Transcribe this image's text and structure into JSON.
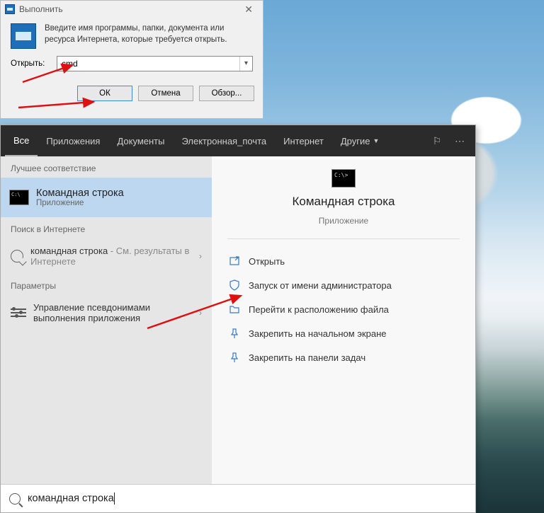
{
  "run": {
    "title": "Выполнить",
    "description": "Введите имя программы, папки, документа или ресурса Интернета, которые требуется открыть.",
    "open_label": "Открыть:",
    "value": "cmd",
    "ok": "ОК",
    "cancel": "Отмена",
    "browse": "Обзор..."
  },
  "search": {
    "tabs": {
      "all": "Все",
      "apps": "Приложения",
      "docs": "Документы",
      "email": "Электронная_почта",
      "internet": "Интернет",
      "more": "Другие"
    },
    "sections": {
      "best": "Лучшее соответствие",
      "web": "Поиск в Интернете",
      "params": "Параметры"
    },
    "best_match": {
      "title": "Командная строка",
      "subtitle": "Приложение"
    },
    "web_item": {
      "query": "командная строка",
      "suffix": " - См. результаты в Интернете"
    },
    "param_item": "Управление псевдонимами выполнения приложения",
    "detail": {
      "title": "Командная строка",
      "subtitle": "Приложение"
    },
    "actions": {
      "open": "Открыть",
      "admin": "Запуск от имени администратора",
      "location": "Перейти к расположению файла",
      "pin_start": "Закрепить на начальном экране",
      "pin_taskbar": "Закрепить на панели задач"
    },
    "input": "командная строка"
  }
}
